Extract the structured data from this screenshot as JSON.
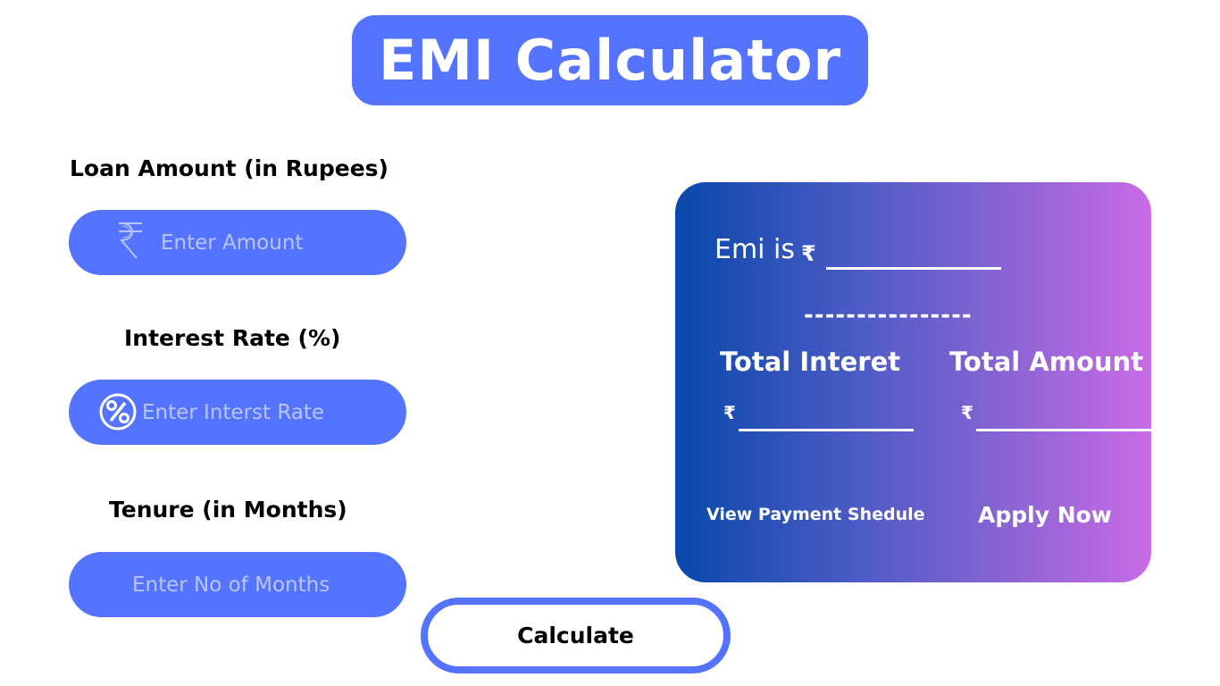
{
  "header": {
    "title": "EMI Calculator"
  },
  "form": {
    "loan_amount_label": "Loan Amount (in Rupees)",
    "loan_amount_placeholder": "Enter Amount",
    "loan_amount_icon": "rupee-icon",
    "interest_rate_label": "Interest Rate (%)",
    "interest_rate_placeholder": "Enter Interst Rate",
    "interest_rate_icon": "percent-icon",
    "tenure_label": "Tenure (in Months)",
    "tenure_placeholder": "Enter No of Months",
    "calculate_label": "Calculate"
  },
  "result": {
    "emi_label": "Emi is",
    "currency_symbol": "₹",
    "separator": "----------------",
    "total_interest_label": "Total Interet",
    "total_amount_label": "Total Amount",
    "view_schedule_label": "View Payment Shedule",
    "apply_now_label": "Apply Now"
  },
  "colors": {
    "accent": "#5473ff",
    "card_gradient_start": "#0848ab",
    "card_gradient_end": "#c96be6",
    "placeholder": "#b9c5ff"
  }
}
